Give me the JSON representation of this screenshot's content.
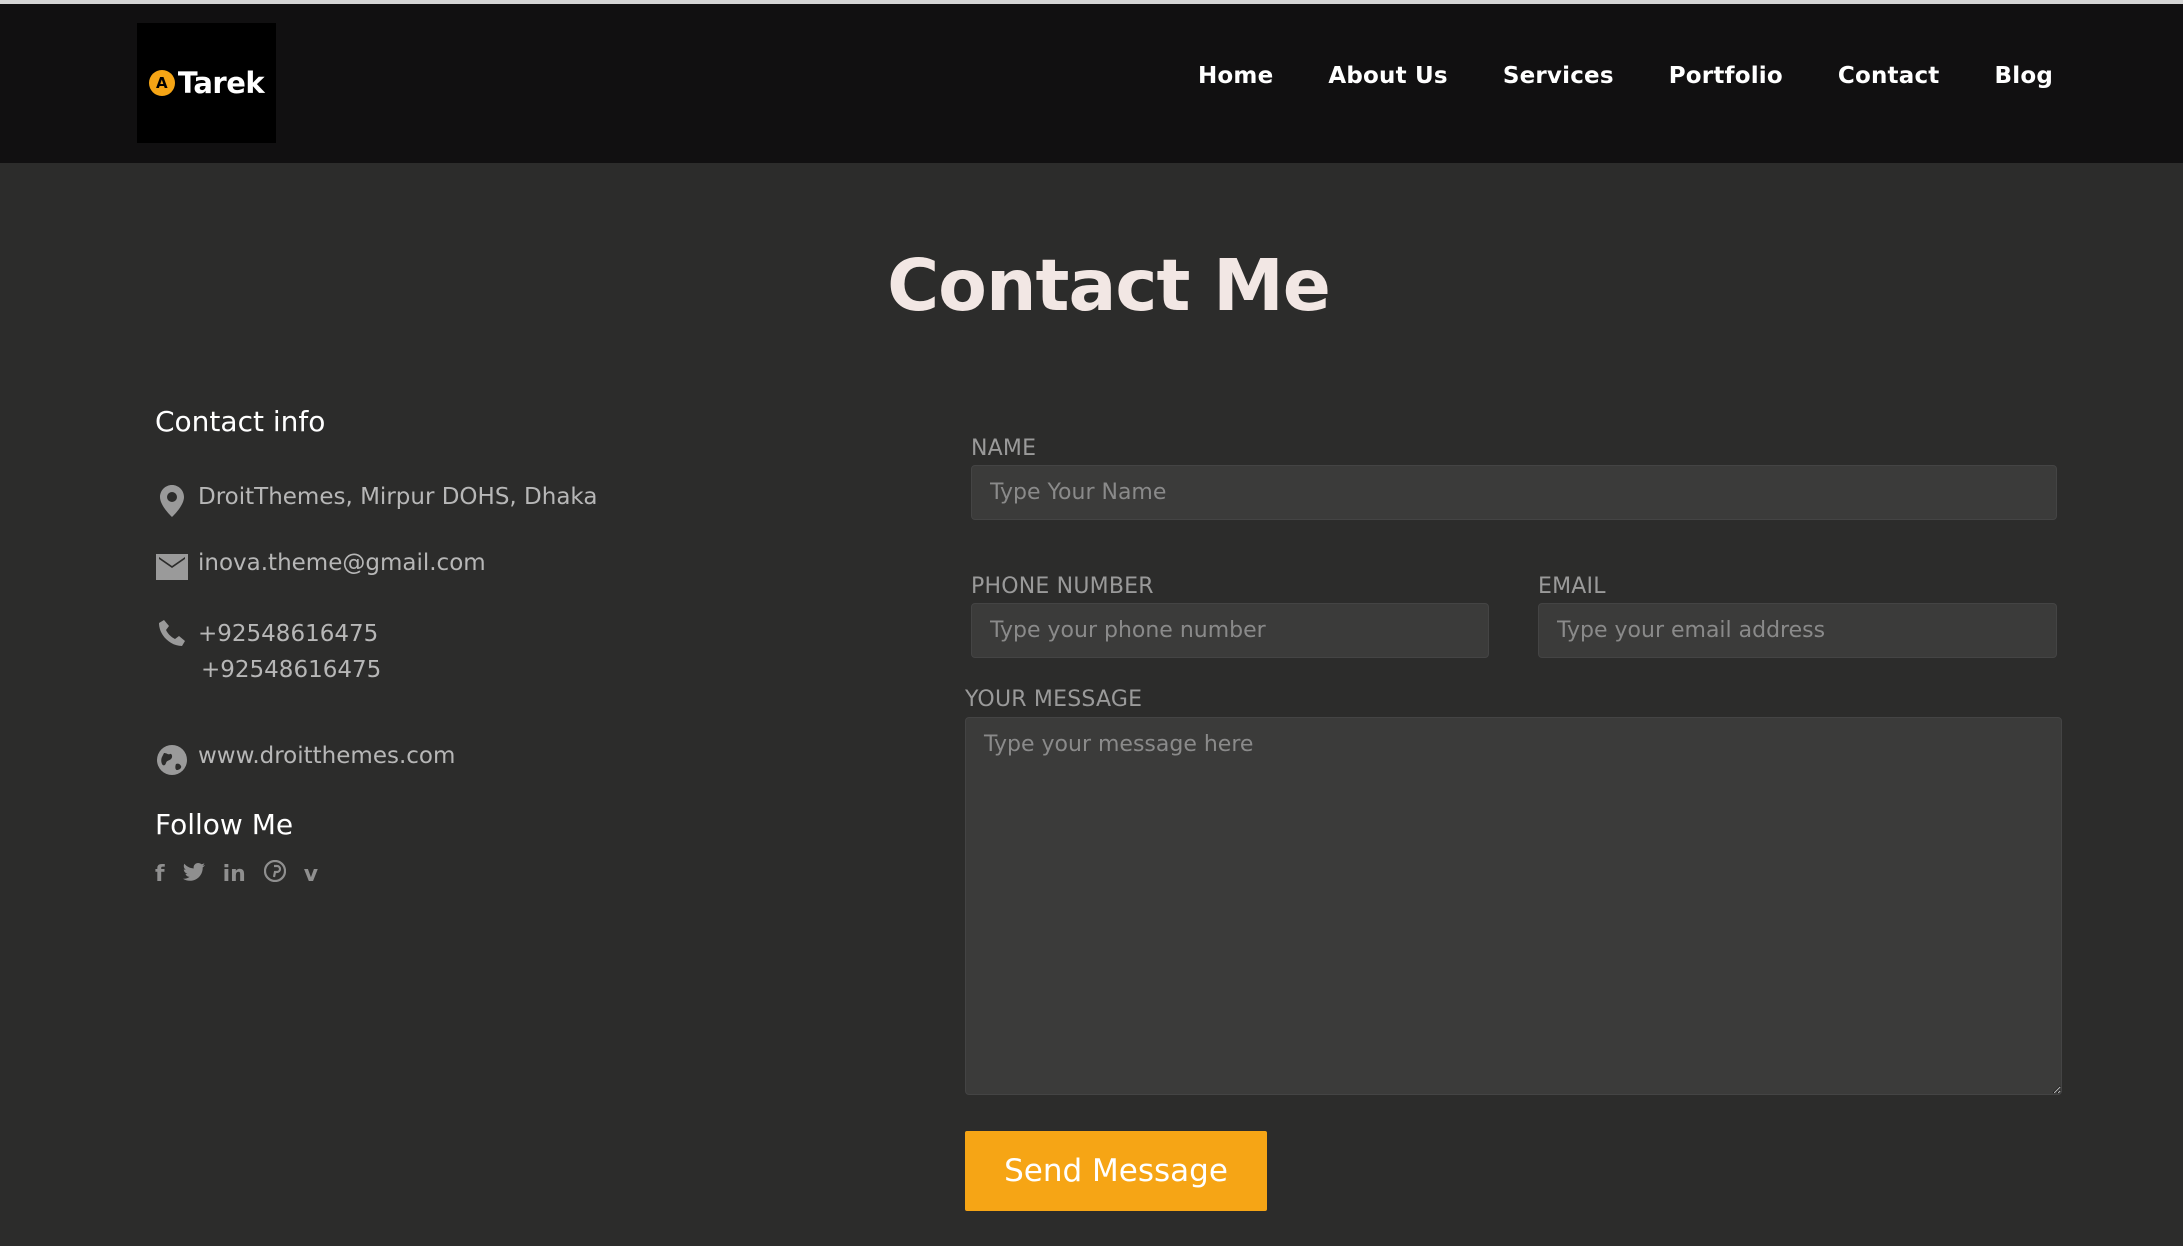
{
  "brand": {
    "name": "Tarek",
    "accent": "#f6a515"
  },
  "nav": [
    "Home",
    "About Us",
    "Services",
    "Portfolio",
    "Contact",
    "Blog"
  ],
  "page_title": "Contact Me",
  "contact_info": {
    "heading": "Contact info",
    "address": "DroitThemes, Mirpur DOHS, Dhaka",
    "email": "inova.theme@gmail.com",
    "phone1": "+92548616475",
    "phone2": "+92548616475",
    "website": "www.droitthemes.com"
  },
  "follow": {
    "heading": "Follow Me",
    "icons": [
      "facebook-icon",
      "twitter-icon",
      "linkedin-icon",
      "pinterest-icon",
      "vimeo-icon"
    ]
  },
  "form": {
    "name_label": "NAME",
    "name_placeholder": "Type Your Name",
    "phone_label": "PHONE NUMBER",
    "phone_placeholder": "Type your phone number",
    "email_label": "EMAIL",
    "email_placeholder": "Type your email address",
    "message_label": "YOUR MESSAGE",
    "message_placeholder": "Type your message here",
    "submit_label": "Send Message"
  }
}
